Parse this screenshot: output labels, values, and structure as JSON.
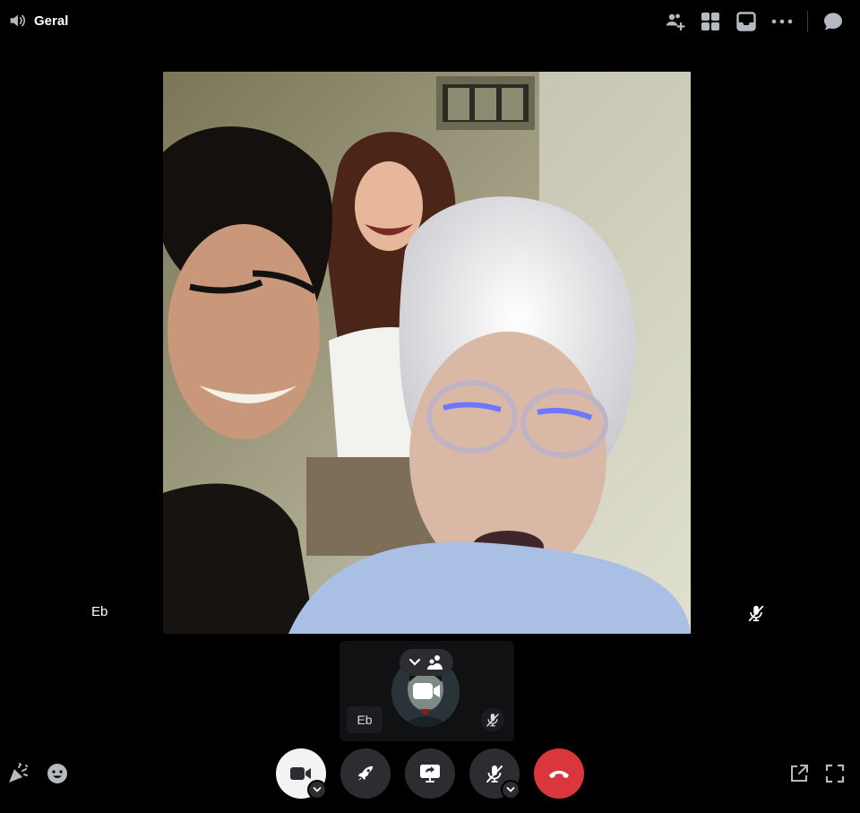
{
  "channel": {
    "name": "Geral",
    "icon": "speaker-icon"
  },
  "topbar_icons": [
    "add-person-icon",
    "grid-icon",
    "inbox-icon",
    "more-icon",
    "chat-icon"
  ],
  "main_tile": {
    "participant": "Eb",
    "muted": true
  },
  "self_tile": {
    "participant": "Eb",
    "muted": true
  },
  "controls": [
    "camera",
    "activity",
    "screen-share",
    "mute",
    "disconnect"
  ],
  "colors": {
    "disconnect": "#da373c",
    "button": "#2b2d31",
    "camera_on": "#f2f3f5"
  }
}
